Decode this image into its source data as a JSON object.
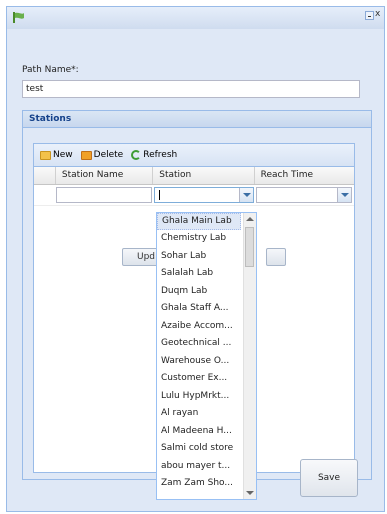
{
  "window": {
    "min_icon": "minimize-icon",
    "close_label": "x"
  },
  "form": {
    "path_label": "Path Name*:",
    "path_value": "test"
  },
  "stations": {
    "title": "Stations",
    "toolbar": {
      "new": "New",
      "delete": "Delete",
      "refresh": "Refresh"
    },
    "columns": [
      "Station Name",
      "Station",
      "Reach Time"
    ],
    "update_label": "Upd"
  },
  "dropdown": {
    "options": [
      "Ghala Main Lab",
      "Chemistry Lab",
      "Sohar Lab",
      "Salalah Lab",
      "Duqm Lab",
      "Ghala Staff A...",
      "Azaibe Accom...",
      "Geotechnical ...",
      "Warehouse O...",
      "Customer Ex...",
      "Lulu HypMrkt...",
      "Al rayan",
      "Al Madeena H...",
      "Salmi cold store",
      "abou mayer t...",
      "Zam Zam Sho..."
    ]
  },
  "save_label": "Save",
  "colors": {
    "panel_bg": "#dfe8f6",
    "border": "#99bbe8",
    "title_text": "#15428b"
  }
}
